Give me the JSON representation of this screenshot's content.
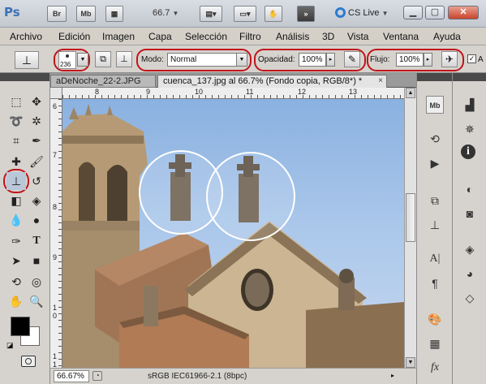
{
  "app": {
    "logo": "Ps",
    "bridge_btn": "Br",
    "minibridge_btn": "Mb",
    "zoom_level": "66.7",
    "cs_live": "CS Live",
    "window_buttons": [
      "▁",
      "▢",
      "✕"
    ]
  },
  "menu": [
    "Archivo",
    "Edición",
    "Imagen",
    "Capa",
    "Selección",
    "Filtro",
    "Análisis",
    "3D",
    "Vista",
    "Ventana",
    "Ayuda"
  ],
  "options": {
    "brush_size": "236",
    "mode_label": "Modo:",
    "mode_value": "Normal",
    "opacity_label": "Opacidad:",
    "opacity_value": "100%",
    "flow_label": "Flujo:",
    "flow_value": "100%",
    "aligned_label": "A"
  },
  "tabs": [
    {
      "label": "aDeNoche_22-2.JPG",
      "active": false
    },
    {
      "label": "cuenca_137.jpg al 66.7% (Fondo copia, RGB/8*) *",
      "active": true,
      "close": "×"
    }
  ],
  "ruler_top": [
    "8",
    "9",
    "10",
    "11",
    "12",
    "13"
  ],
  "ruler_left": [
    "6",
    "7",
    "8",
    "9",
    "1",
    "0",
    "1",
    "1"
  ],
  "status": {
    "zoom": "66.67%",
    "profile": "sRGB IEC61966-2.1 (8bpc)"
  },
  "colors": {
    "highlight_ring": "#c0141a",
    "foreground": "#000000",
    "background": "#ffffff"
  }
}
